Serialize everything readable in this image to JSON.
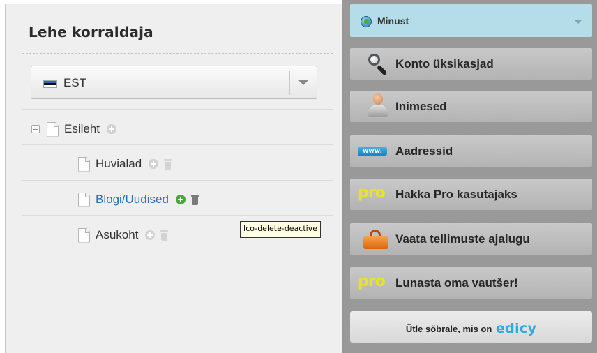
{
  "left_panel": {
    "title": "Lehe korraldaja",
    "language": {
      "selected": "EST"
    },
    "pages": [
      {
        "label": "Esileht",
        "level": 0,
        "collapsible": true,
        "active": false
      },
      {
        "label": "Huvialad",
        "level": 1,
        "active": false
      },
      {
        "label": "Blogi/Uudised",
        "level": 1,
        "active": true
      },
      {
        "label": "Asukoht",
        "level": 1,
        "active": false
      }
    ],
    "tooltip": "Ico-delete-deactive"
  },
  "right_panel": {
    "header": {
      "label": "Minust",
      "icon": "globe-icon"
    },
    "items": [
      {
        "label": "Konto üksikasjad",
        "icon": "magnifier-icon"
      },
      {
        "label": "Inimesed",
        "icon": "person-icon"
      },
      {
        "label": "Aadressid",
        "icon": "www-icon",
        "icon_text": "www."
      },
      {
        "label": "Hakka Pro kasutajaks",
        "icon": "pro-icon",
        "icon_text": "pro"
      },
      {
        "label": "Vaata tellimuste ajalugu",
        "icon": "shopping-basket-icon"
      },
      {
        "label": "Lunasta oma vautšer!",
        "icon": "pro-icon",
        "icon_text": "pro"
      }
    ],
    "tell_friend": {
      "text": "Ütle sõbrale, mis on",
      "brand": "edicy"
    }
  },
  "colors": {
    "sidebar_bg": "#999999",
    "header_bg": "#b4dde9",
    "active_link": "#2a6ebb",
    "add_active": "#4aa83c",
    "pro_yellow": "#e8e22a",
    "brand_blue": "#2fa9e1"
  }
}
